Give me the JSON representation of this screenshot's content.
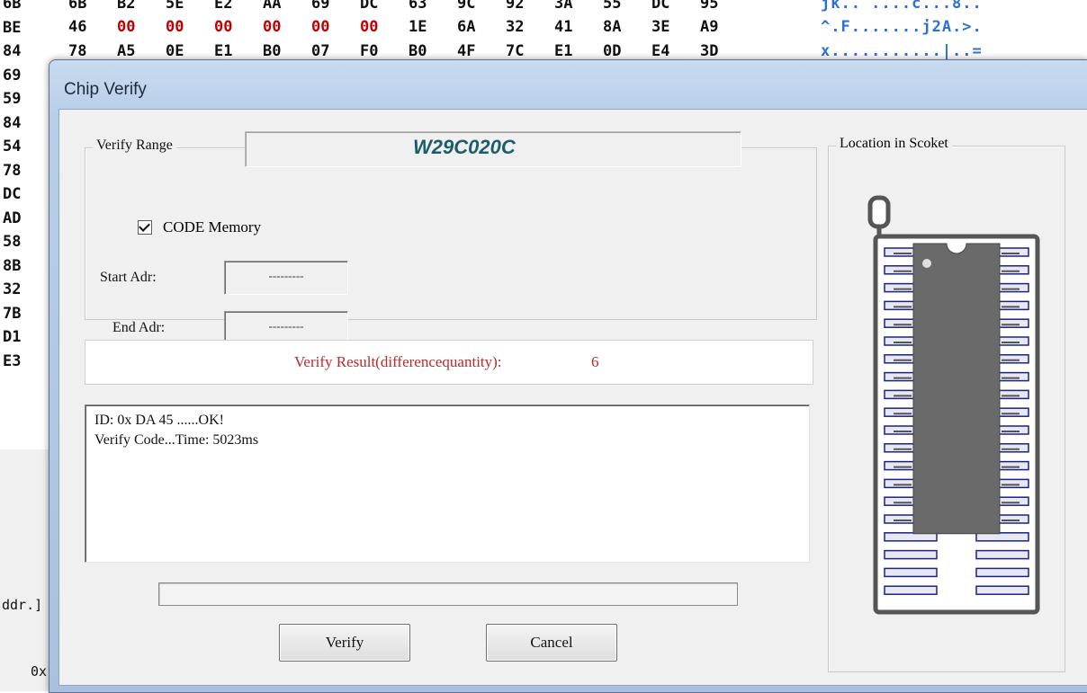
{
  "hex_editor": {
    "rows": [
      {
        "cells": [
          "6B",
          "B2",
          "5E",
          "E2",
          "AA",
          "69",
          "DC",
          "63",
          "9C",
          "92",
          "3A",
          "55",
          "DC",
          "95"
        ],
        "ascii": "jk.. ....c...8.."
      },
      {
        "cells": [
          "46",
          "00",
          "00",
          "00",
          "00",
          "00",
          "00",
          "1E",
          "6A",
          "32",
          "41",
          "8A",
          "3E",
          "A9"
        ],
        "ascii": "^.F.......j2A.>."
      },
      {
        "cells": [
          "78",
          "A5",
          "0E",
          "E1",
          "B0",
          "07",
          "F0",
          "B0",
          "4F",
          "7C",
          "E1",
          "0D",
          "E4",
          "3D"
        ],
        "ascii": "x...........|..="
      }
    ],
    "red_value": "00",
    "row_labels": [
      "6B",
      "BE",
      "84",
      "69",
      "59",
      "84",
      "54",
      "78",
      "DC",
      "AD",
      "58",
      "8B",
      "32",
      "7B",
      "D1",
      "E3"
    ],
    "bottom_labels": [
      "ddr.]",
      "0x"
    ]
  },
  "dialog": {
    "title": "Chip Verify",
    "verify_range_label": "Verify Range",
    "chip_name": "W29C020C",
    "code_memory_label": "CODE Memory",
    "code_memory_checked": true,
    "start_adr_label": "Start Adr:",
    "start_adr_value": "---------",
    "end_adr_label": "End Adr:",
    "end_adr_value": "---------",
    "result_label": "Verify Result(differencequantity):",
    "result_value": "6",
    "log_lines": [
      "ID: 0x DA 45 ......OK!",
      "Verify Code...Time: 5023ms"
    ],
    "progress": 0,
    "verify_button": "Verify",
    "cancel_button": "Cancel",
    "socket_label": "Location in Scoket"
  },
  "colors": {
    "chip_name": "#1b5e6a",
    "result_text": "#c0282a",
    "hex_red": "#c00000",
    "ascii": "#2c6fd6",
    "socket_outline": "#555555",
    "chip_body": "#6a6a6a",
    "pin_fill": "#e8e8f5",
    "pin_stroke": "#1a237e"
  },
  "socket": {
    "icon": "dip-socket-icon",
    "pins_per_side": 20,
    "chip_pins_per_side": 16
  }
}
